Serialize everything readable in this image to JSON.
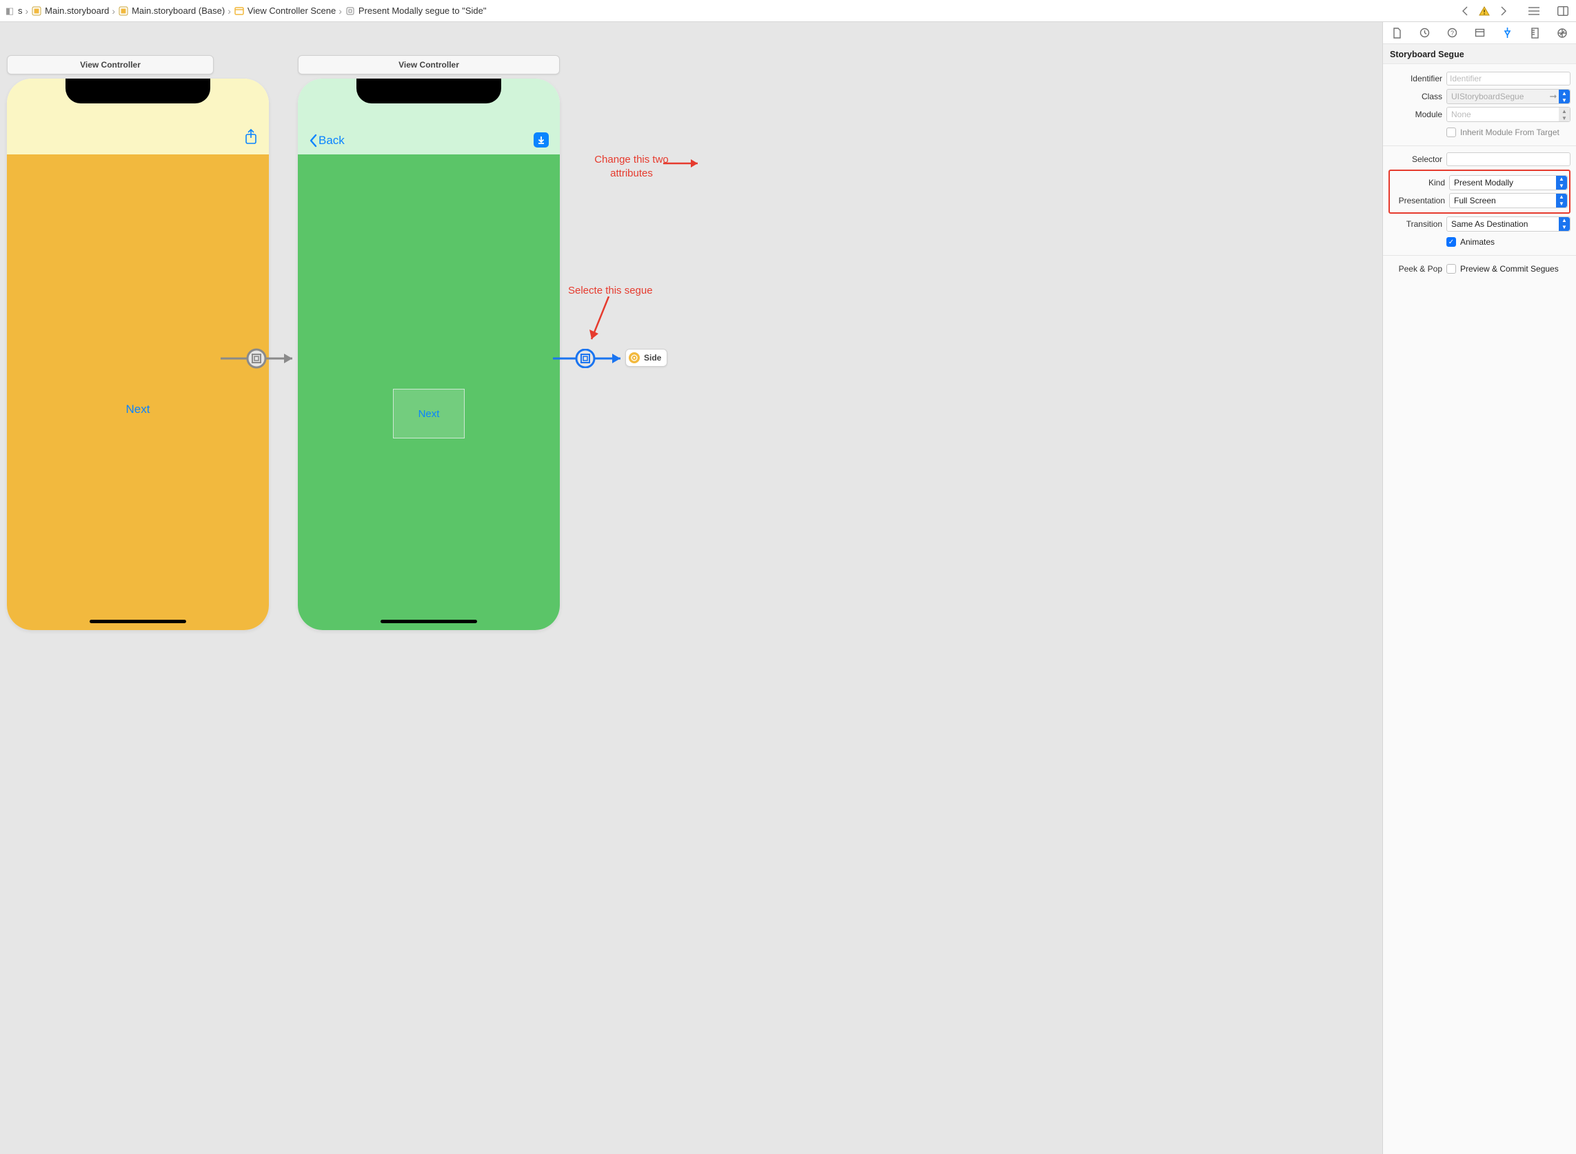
{
  "breadcrumb": {
    "items": [
      {
        "label": "s",
        "icon": "swift"
      },
      {
        "label": "Main.storyboard",
        "icon": "storyboard"
      },
      {
        "label": "Main.storyboard (Base)",
        "icon": "storyboard"
      },
      {
        "label": "View Controller Scene",
        "icon": "scene"
      },
      {
        "label": "Present Modally segue to \"Side\"",
        "icon": "segue"
      }
    ]
  },
  "vc1": {
    "title": "View Controller",
    "button": "Next"
  },
  "vc2": {
    "title": "View Controller",
    "back": "Back",
    "button": "Next"
  },
  "sideChip": {
    "label": "Side"
  },
  "annotations": {
    "attrs": "Change this two\nattributes",
    "segue": "Selecte this segue"
  },
  "inspector": {
    "sectionTitle": "Storyboard Segue",
    "labels": {
      "identifier": "Identifier",
      "class": "Class",
      "module": "Module",
      "inherit": "Inherit Module From Target",
      "selector": "Selector",
      "kind": "Kind",
      "presentation": "Presentation",
      "transition": "Transition",
      "animates": "Animates",
      "peekpop": "Peek & Pop",
      "previewcommit": "Preview & Commit Segues"
    },
    "values": {
      "identifier_placeholder": "Identifier",
      "identifier": "",
      "class": "UIStoryboardSegue",
      "module": "None",
      "inherit_checked": false,
      "selector": "",
      "kind": "Present Modally",
      "presentation": "Full Screen",
      "transition": "Same As Destination",
      "animates_checked": true,
      "previewcommit_checked": false
    }
  }
}
